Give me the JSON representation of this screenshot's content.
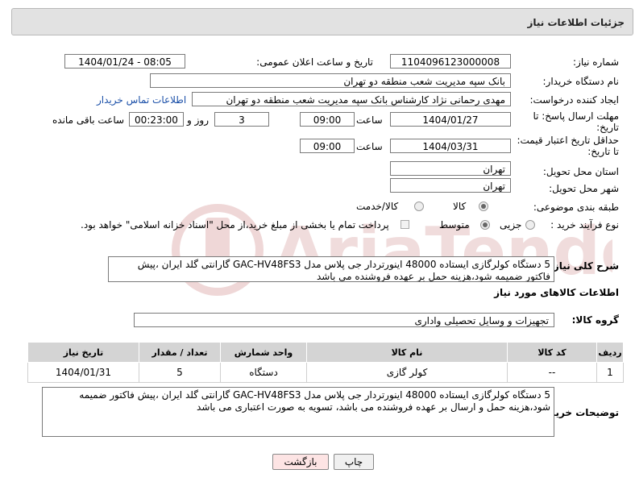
{
  "header": {
    "title": "جزئیات اطلاعات نیاز"
  },
  "form": {
    "need_number_label": "شماره نیاز:",
    "need_number": "1104096123000008",
    "announce_label": "تاریخ و ساعت اعلان عمومی:",
    "announce_value": "1404/01/24 - 08:05",
    "buyer_org_label": "نام دستگاه خریدار:",
    "buyer_org": "بانک سپه مدیریت شعب منطقه دو تهران",
    "creator_label": "ایجاد کننده درخواست:",
    "creator": "مهدی رحمانی نژاد کارشناس بانک سپه مدیریت شعب منطقه دو تهران",
    "contact_link": "اطلاعات تماس خریدار",
    "deadline_label_1": "مهلت ارسال پاسخ: تا",
    "deadline_label_2": "تاریخ:",
    "deadline_date": "1404/01/27",
    "time_label": "ساعت",
    "deadline_time": "09:00",
    "days_value": "3",
    "days_label": "روز و",
    "remaining_time": "00:23:00",
    "remaining_label": "ساعت باقی مانده",
    "validity_label_1": "حداقل تاریخ اعتبار قیمت:",
    "validity_label_2": "تا تاریخ:",
    "validity_date": "1404/03/31",
    "validity_time": "09:00",
    "province_label": "استان محل تحویل:",
    "province": "تهران",
    "city_label": "شهر محل تحویل:",
    "city": "تهران",
    "category_label": "طبقه بندی موضوعی:",
    "category_options": [
      "کالا",
      "کالا/خدمت"
    ],
    "process_label": "نوع فرآیند خرید :",
    "process_options": [
      "جزیی",
      "متوسط"
    ],
    "payment_note": "پرداخت تمام یا بخشی از مبلغ خرید،از محل \"اسناد خزانه اسلامی\" خواهد بود.",
    "summary_label": "شرح کلی نیاز:",
    "summary_text": "5 دستگاه کولرگازی ایستاده 48000 اینورتردار جی پلاس  مدل GAC-HV48FS3 گارانتی گلد ایران ،پیش فاکتور ضمیمه شود،هزینه حمل بر عهده فروشنده می باشد"
  },
  "goods": {
    "section_title": "اطلاعات کالاهای مورد نیاز",
    "group_label": "گروه کالا:",
    "group_value": "تجهیزات و وسایل تحصیلی واداری",
    "columns": [
      "ردیف",
      "کد کالا",
      "نام کالا",
      "واحد شمارش",
      "تعداد / مقدار",
      "تاریخ نیاز"
    ],
    "rows": [
      {
        "index": "1",
        "code": "--",
        "name": "کولر گازی",
        "unit": "دستگاه",
        "qty": "5",
        "date": "1404/01/31"
      }
    ]
  },
  "buyer_notes": {
    "label": "توضیحات خریدار:",
    "text": "5 دستگاه کولرگازی ایستاده 48000 اینورتردار جی پلاس  مدل GAC-HV48FS3 گارانتی گلد ایران ،پیش فاکتور  ضمیمه شود،هزینه حمل و ارسال بر عهده فروشنده می باشد، تسویه به صورت اعتباری می باشد"
  },
  "buttons": {
    "print": "چاپ",
    "back": "بازگشت"
  },
  "colors": {
    "back_button_bg": "#fde4e4",
    "link": "#1a4fa8",
    "watermark": "#e9c9c9"
  }
}
